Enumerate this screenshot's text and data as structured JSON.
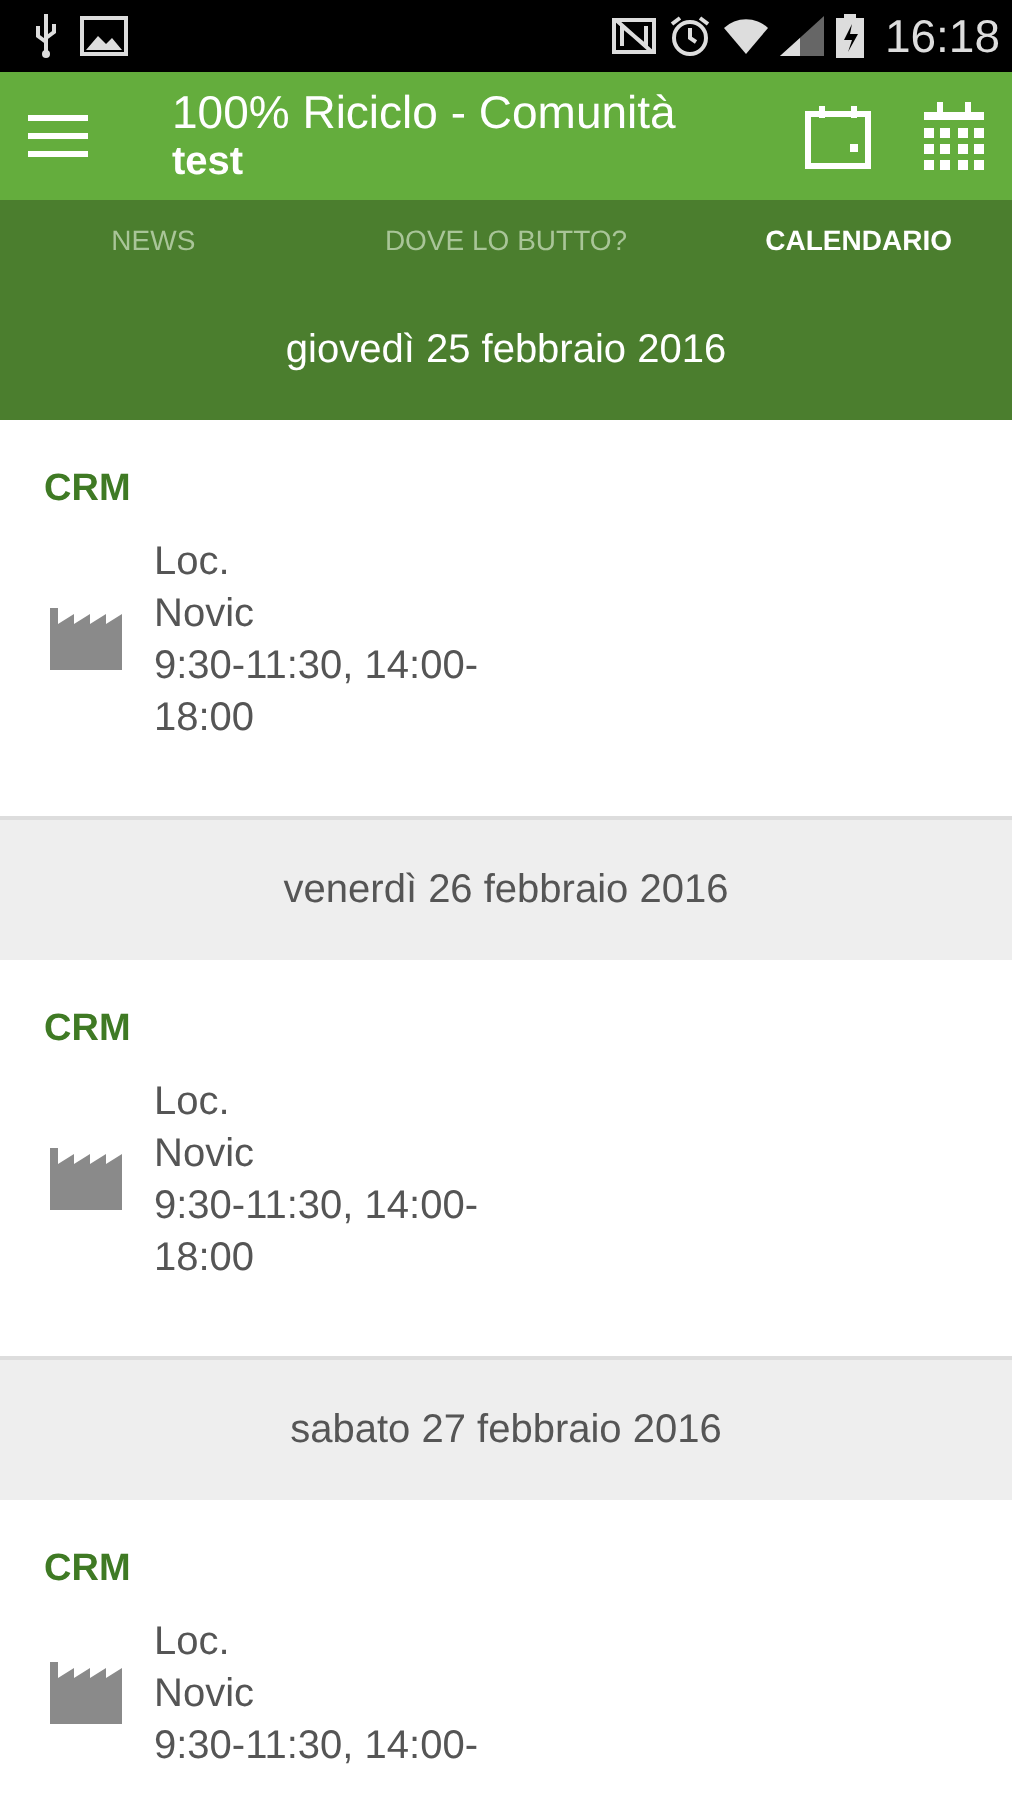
{
  "status_bar": {
    "time": "16:18"
  },
  "toolbar": {
    "title": "100% Riciclo - Comunità",
    "subtitle": "test"
  },
  "tabs": [
    {
      "label": "NEWS",
      "selected": false
    },
    {
      "label": "DOVE LO BUTTO?",
      "selected": false
    },
    {
      "label": "CALENDARIO",
      "selected": true
    }
  ],
  "days": [
    {
      "date": "giovedì 25 febbraio 2016",
      "selected": true,
      "events": [
        {
          "name": "CRM",
          "lines": [
            "Loc.",
            "Novic",
            "9:30-11:30, 14:00-",
            "18:00"
          ]
        }
      ]
    },
    {
      "date": "venerdì 26 febbraio 2016",
      "selected": false,
      "events": [
        {
          "name": "CRM",
          "lines": [
            "Loc.",
            "Novic",
            "9:30-11:30, 14:00-",
            "18:00"
          ]
        }
      ]
    },
    {
      "date": "sabato 27 febbraio 2016",
      "selected": false,
      "events": [
        {
          "name": "CRM",
          "lines": [
            "Loc.",
            "Novic",
            "9:30-11:30, 14:00-"
          ]
        }
      ]
    }
  ]
}
